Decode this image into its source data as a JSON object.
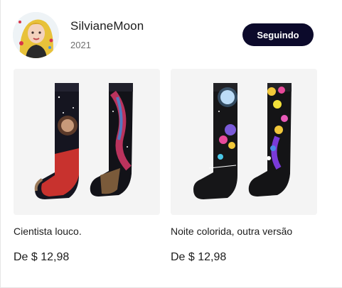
{
  "profile": {
    "username": "SilvianeMoon",
    "year": "2021",
    "follow_label": "Seguindo"
  },
  "products": [
    {
      "title": "Cientista louco.",
      "price": "De $ 12,98"
    },
    {
      "title": "Noite colorida, outra versão",
      "price": "De $ 12,98"
    }
  ],
  "colors": {
    "button_bg": "#0c0a2b",
    "thumb_bg": "#f4f4f4",
    "sock_base": "#1a1a1a"
  }
}
